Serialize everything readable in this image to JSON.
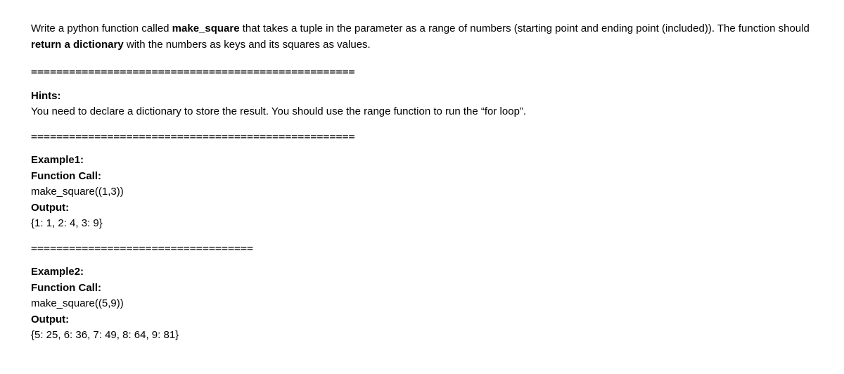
{
  "intro": {
    "prefix": "Write a python function called ",
    "funcName": "make_square",
    "middle": " that takes a tuple in the parameter as a range of numbers (starting point and ending point (included)). The function should ",
    "returnPhrase": "return a dictionary",
    "suffix": " with the numbers as keys and its squares as values."
  },
  "separator1": "===================================================",
  "hints": {
    "label": "Hints:",
    "text": "You need to declare a dictionary to store the result. You should use the range function to run the “for loop”."
  },
  "separator2": "===================================================",
  "example1": {
    "title": "Example1:",
    "callLabel": "Function Call:",
    "call": "make_square((1,3))",
    "outputLabel": "Output:",
    "output": "{1: 1, 2: 4, 3: 9}"
  },
  "separator3": "===================================",
  "example2": {
    "title": "Example2:",
    "callLabel": "Function Call:",
    "call": "make_square((5,9))",
    "outputLabel": "Output:",
    "output": "{5: 25, 6: 36, 7: 49, 8: 64, 9: 81}"
  }
}
